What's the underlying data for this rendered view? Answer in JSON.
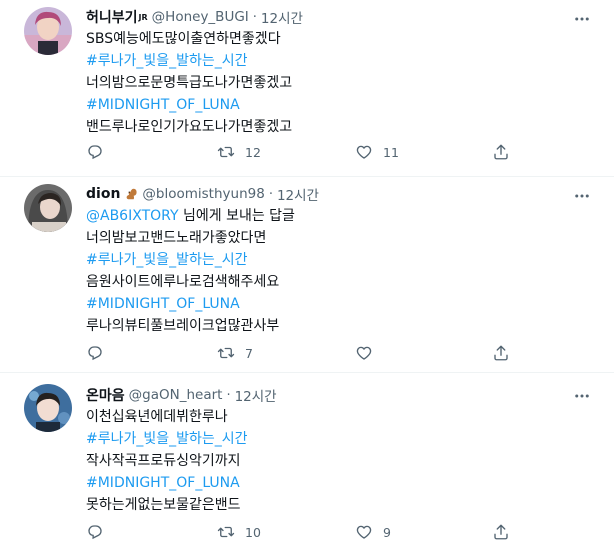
{
  "tweets": [
    {
      "display_name": "허니부기",
      "badge": "JR",
      "handle": "@Honey_BUGI",
      "time": "12시간",
      "lines": [
        {
          "text": "SBS예능에도많이출연하면좋겠다",
          "link": false
        },
        {
          "text": "#루나가_빛을_발하는_시간",
          "link": true
        },
        {
          "text": "너의밤으로문명특급도나가면좋겠고",
          "link": false
        },
        {
          "text": "#MIDNIGHT_OF_LUNA",
          "link": true
        },
        {
          "text": "밴드루나로인기가요도나가면좋겠고",
          "link": false
        }
      ],
      "replies": "",
      "retweets": "12",
      "likes": "11"
    },
    {
      "display_name": "dion",
      "handle": "@bloomisthyun98",
      "time": "12시간",
      "reply_mention": "@AB6IXTORY",
      "reply_suffix": " 님에게 보내는 답글",
      "lines": [
        {
          "text": "너의밤보고밴드노래가좋았다면",
          "link": false
        },
        {
          "text": "#루나가_빛을_발하는_시간",
          "link": true
        },
        {
          "text": "음원사이트에루나로검색해주세요",
          "link": false
        },
        {
          "text": "#MIDNIGHT_OF_LUNA",
          "link": true
        },
        {
          "text": "루나의뷰티풀브레이크업많관사부",
          "link": false
        }
      ],
      "replies": "",
      "retweets": "7",
      "likes": ""
    },
    {
      "display_name": "온마음",
      "handle": "@gaON_heart",
      "time": "12시간",
      "lines": [
        {
          "text": "이천십육년에데뷔한루나",
          "link": false
        },
        {
          "text": "#루나가_빛을_발하는_시간",
          "link": true
        },
        {
          "text": "작사작곡프로듀싱악기까지",
          "link": false
        },
        {
          "text": "#MIDNIGHT_OF_LUNA",
          "link": true
        },
        {
          "text": "못하는게없는보물같은밴드",
          "link": false
        }
      ],
      "replies": "",
      "retweets": "10",
      "likes": "9"
    }
  ],
  "colors": {
    "link": "#1d9bf0",
    "secondary_text": "#536471",
    "divider": "#eff3f4"
  },
  "icons": [
    "more-icon",
    "reply-icon",
    "retweet-icon",
    "like-icon",
    "share-icon",
    "squirrel-emoji"
  ]
}
